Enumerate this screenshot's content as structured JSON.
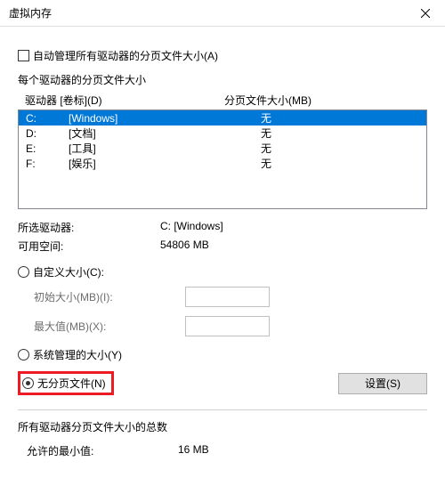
{
  "title": "虚拟内存",
  "auto_manage": "自动管理所有驱动器的分页文件大小(A)",
  "each_drive_label": "每个驱动器的分页文件大小",
  "headers": {
    "drive": "驱动器 [卷标](D)",
    "size": "分页文件大小(MB)"
  },
  "drives": [
    {
      "letter": "C:",
      "label": "[Windows]",
      "size": "无",
      "selected": true
    },
    {
      "letter": "D:",
      "label": "[文档]",
      "size": "无",
      "selected": false
    },
    {
      "letter": "E:",
      "label": "[工具]",
      "size": "无",
      "selected": false
    },
    {
      "letter": "F:",
      "label": "[娱乐]",
      "size": "无",
      "selected": false
    }
  ],
  "selected_drive": {
    "label": "所选驱动器:",
    "value": "C:  [Windows]"
  },
  "free_space": {
    "label": "可用空间:",
    "value": "54806 MB"
  },
  "custom_size": "自定义大小(C):",
  "initial_size": "初始大小(MB)(I):",
  "max_size": "最大值(MB)(X):",
  "system_managed": "系统管理的大小(Y)",
  "no_paging": "无分页文件(N)",
  "set_button": "设置(S)",
  "total_label": "所有驱动器分页文件大小的总数",
  "min_allowed": {
    "label": "允许的最小值:",
    "value": "16 MB"
  }
}
